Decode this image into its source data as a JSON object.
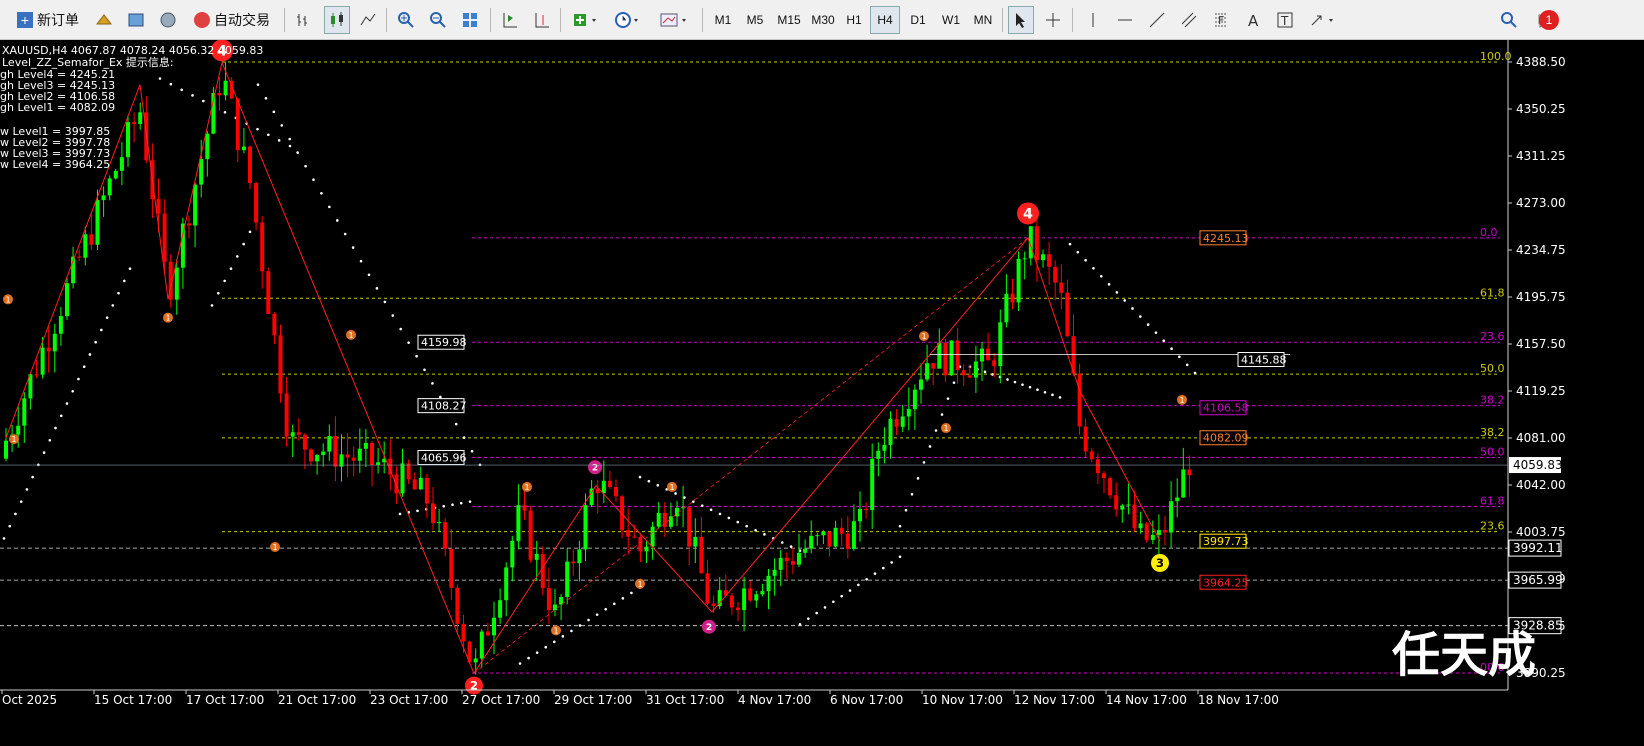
{
  "toolbar": {
    "new_order": "新订单",
    "auto_trading": "自动交易",
    "timeframes": [
      "M1",
      "M5",
      "M15",
      "M30",
      "H1",
      "H4",
      "D1",
      "W1",
      "MN"
    ],
    "active_timeframe": "H4",
    "notification_count": "1"
  },
  "chart": {
    "symbol_info": "XAUUSD,H4  4067.87 4078.24 4056.32 4059.83",
    "indicator_title": "Level_ZZ_Semafor_Ex 提示信息:",
    "high_levels": [
      "gh Level4 = 4245.21",
      "gh Level3 = 4245.13",
      "gh Level2 = 4106.58",
      "gh Level1 = 4082.09"
    ],
    "low_levels": [
      "w Level1 = 3997.85",
      "w Level2 = 3997.78",
      "w Level3 = 3997.73",
      "w Level4 = 3964.25"
    ],
    "price_axis": [
      "4388.50",
      "4350.25",
      "4311.25",
      "4273.00",
      "4234.75",
      "4195.75",
      "4157.50",
      "4119.25",
      "4081.00",
      "4042.00",
      "4003.75",
      "3965.99",
      "3928.85",
      "3890.25"
    ],
    "current_price": "4059.83",
    "price_tags": [
      "3992.11",
      "3965.99",
      "3928.85"
    ],
    "time_axis": [
      "Oct 2025",
      "15 Oct 17:00",
      "17 Oct 17:00",
      "21 Oct 17:00",
      "23 Oct 17:00",
      "27 Oct 17:00",
      "29 Oct 17:00",
      "31 Oct 17:00",
      "4 Nov 17:00",
      "6 Nov 17:00",
      "10 Nov 17:00",
      "12 Nov 17:00",
      "14 Nov 17:00",
      "18 Nov 17:00"
    ],
    "fib_labels_yellow": [
      "100.0",
      "61.8",
      "50.0",
      "38.2",
      "23.6"
    ],
    "fib_labels_magenta": [
      "0.0",
      "23.6",
      "38.2",
      "50.0",
      "61.8",
      "00.0"
    ],
    "boxed_labels_white": [
      "4159.98",
      "4108.27",
      "4065.96",
      "4145.88"
    ],
    "boxed_labels_colored": [
      "4245.13",
      "4106.58",
      "4082.09",
      "3997.73",
      "3964.25"
    ],
    "semafor_numbers": [
      "4",
      "4",
      "3",
      "2",
      "2",
      "2",
      "1"
    ],
    "watermark": "任天成",
    "colors": {
      "bull": "#00ff00",
      "bear": "#ff0000",
      "fib_yellow": "#cccc00",
      "fib_magenta": "#cc00cc",
      "semafor_orange": "#e07020",
      "semafor_red": "#ff2020",
      "semafor_pink": "#d0208a",
      "semafor_yellow": "#ffee00"
    }
  }
}
